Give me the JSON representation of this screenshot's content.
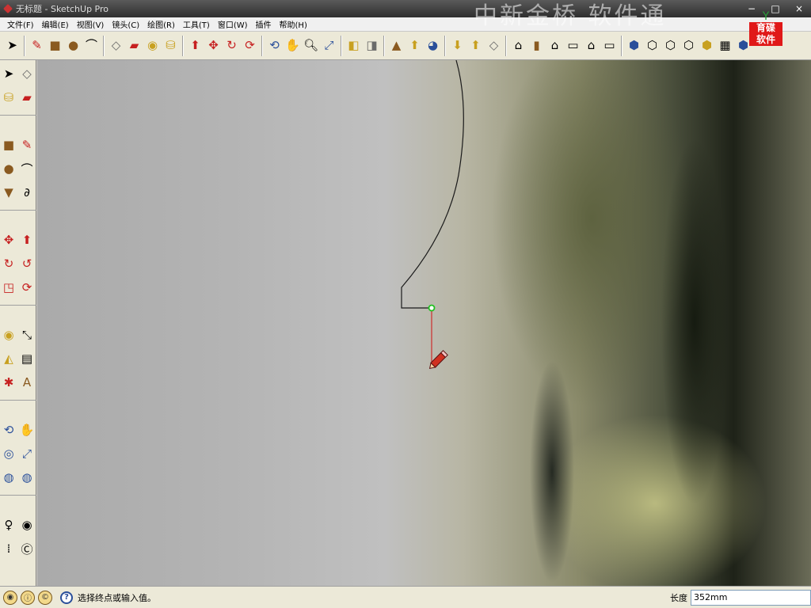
{
  "window": {
    "title": "无标题 - SketchUp Pro",
    "buttons": {
      "minimize": "−",
      "maximize": "□",
      "close": "×"
    }
  },
  "menu": [
    "文件(F)",
    "编辑(E)",
    "视图(V)",
    "镜头(C)",
    "绘图(R)",
    "工具(T)",
    "窗口(W)",
    "插件",
    "帮助(H)"
  ],
  "watermark": "中新金桥 软件通",
  "logo": {
    "mark": "Y",
    "line1": "育碟",
    "line2": "软件"
  },
  "status": {
    "hint": "选择终点或输入值。",
    "vcb_label": "长度",
    "vcb_value": "352mm"
  },
  "colors": {
    "line": "#1a1a1a",
    "inference_red_axis": "#d01010",
    "endpoint": "#20c020",
    "pencil": "#d03020"
  }
}
